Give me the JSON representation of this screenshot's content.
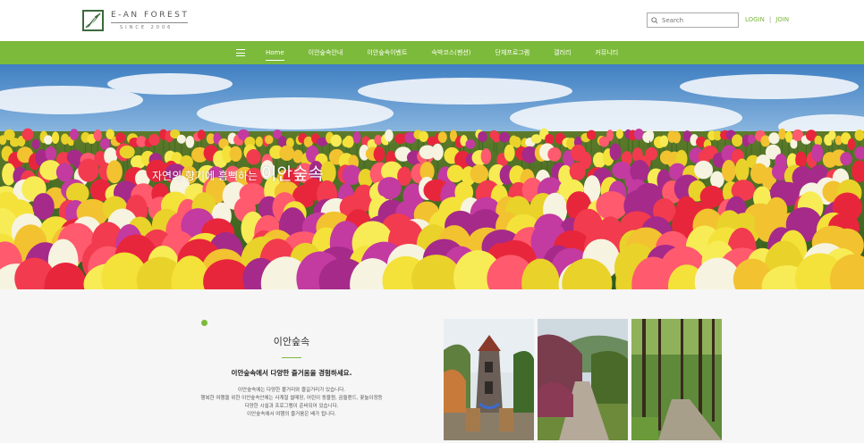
{
  "header": {
    "logo": {
      "name": "E-AN FOREST",
      "since": "SINCE 2006"
    },
    "search": {
      "placeholder": "Search"
    },
    "auth": {
      "login": "LOGIN",
      "separator": "|",
      "join": "JOIN"
    }
  },
  "nav": {
    "items": [
      {
        "label": "Home",
        "active": true
      },
      {
        "label": "이안숲속안내"
      },
      {
        "label": "이안숲속이벤트"
      },
      {
        "label": "숙박코스(펜션)"
      },
      {
        "label": "단체프로그램"
      },
      {
        "label": "갤러리"
      },
      {
        "label": "커뮤니티"
      }
    ]
  },
  "hero": {
    "caption_small": "자연의 향기에 흠뻑하는",
    "caption_big": "이안숲속"
  },
  "intro": {
    "title": "이안숲속",
    "subtitle": "이안숲속에서 다양한 즐거움을 경험하세요.",
    "lines": [
      "이안숲속에는 다양한 볼거리와 즐길거리가 있습니다.",
      "행복한 여행을 위한 이안숲속안에는 사계절 썰매장, 어린이 동물원, 곰돌랜드, 꽃놀이정등",
      "다양한 시설과 프로그램이 준비되어 있습니다.",
      "이안숲속에서 여행의 즐거움은 배가 됩니다."
    ]
  },
  "colors": {
    "accent": "#7cba3b",
    "nav_bg": "#7cba3b"
  },
  "icons": {
    "search": "search-icon",
    "menu": "menu-icon",
    "logo": "leaf-logo-icon"
  }
}
